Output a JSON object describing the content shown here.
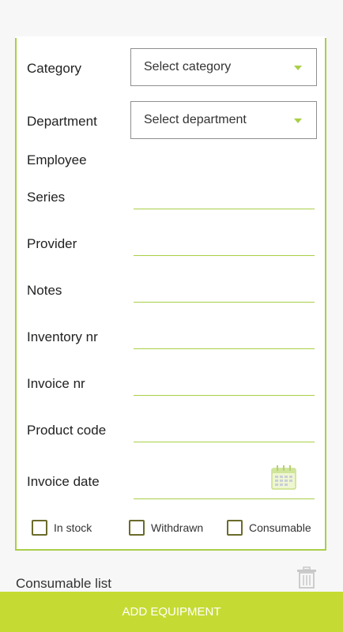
{
  "form": {
    "category": {
      "label": "Category",
      "value": "Select category"
    },
    "department": {
      "label": "Department",
      "value": "Select department"
    },
    "employee": {
      "label": "Employee"
    },
    "series": {
      "label": "Series",
      "value": ""
    },
    "provider": {
      "label": "Provider",
      "value": ""
    },
    "notes": {
      "label": "Notes",
      "value": ""
    },
    "inventory_nr": {
      "label": "Inventory nr",
      "value": ""
    },
    "invoice_nr": {
      "label": "Invoice nr",
      "value": ""
    },
    "product_code": {
      "label": "Product code",
      "value": ""
    },
    "invoice_date": {
      "label": "Invoice date",
      "value": "",
      "icon": "calendar-icon"
    },
    "checkboxes": [
      {
        "label": "In stock",
        "checked": false
      },
      {
        "label": "Withdrawn",
        "checked": false
      },
      {
        "label": "Consumable",
        "checked": false
      }
    ]
  },
  "below": {
    "partial_text": "Consumable list",
    "icon": "trash-icon"
  },
  "footer": {
    "button_label": "ADD EQUIPMENT"
  },
  "colors": {
    "accent": "#a9cf46",
    "button": "#c5db33"
  }
}
